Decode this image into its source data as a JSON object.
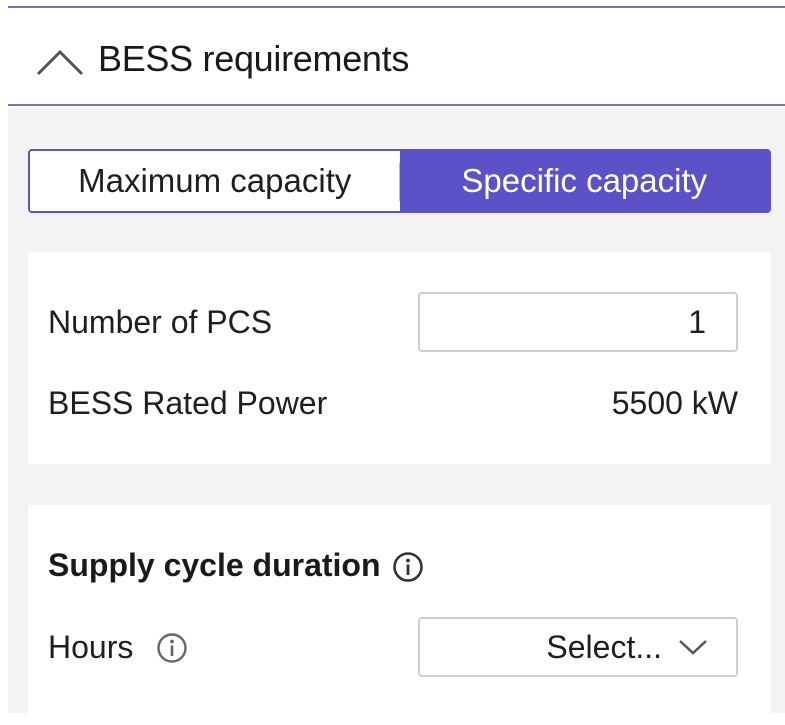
{
  "section": {
    "title": "BESS requirements"
  },
  "capacity_toggle": {
    "options": [
      {
        "label": "Maximum capacity",
        "selected": false
      },
      {
        "label": "Specific capacity",
        "selected": true
      }
    ]
  },
  "pcs_card": {
    "number_of_pcs_label": "Number of PCS",
    "number_of_pcs_value": "1",
    "rated_power_label": "BESS Rated Power",
    "rated_power_value": "5500 kW"
  },
  "supply_cycle": {
    "title": "Supply cycle duration",
    "hours_label": "Hours",
    "hours_select": "Select..."
  },
  "colors": {
    "accent": "#5b52c7",
    "divider": "#7a74b8",
    "background": "#f3f3f3"
  },
  "icons": [
    "chevron-up-icon",
    "info-icon",
    "chevron-down-icon"
  ]
}
